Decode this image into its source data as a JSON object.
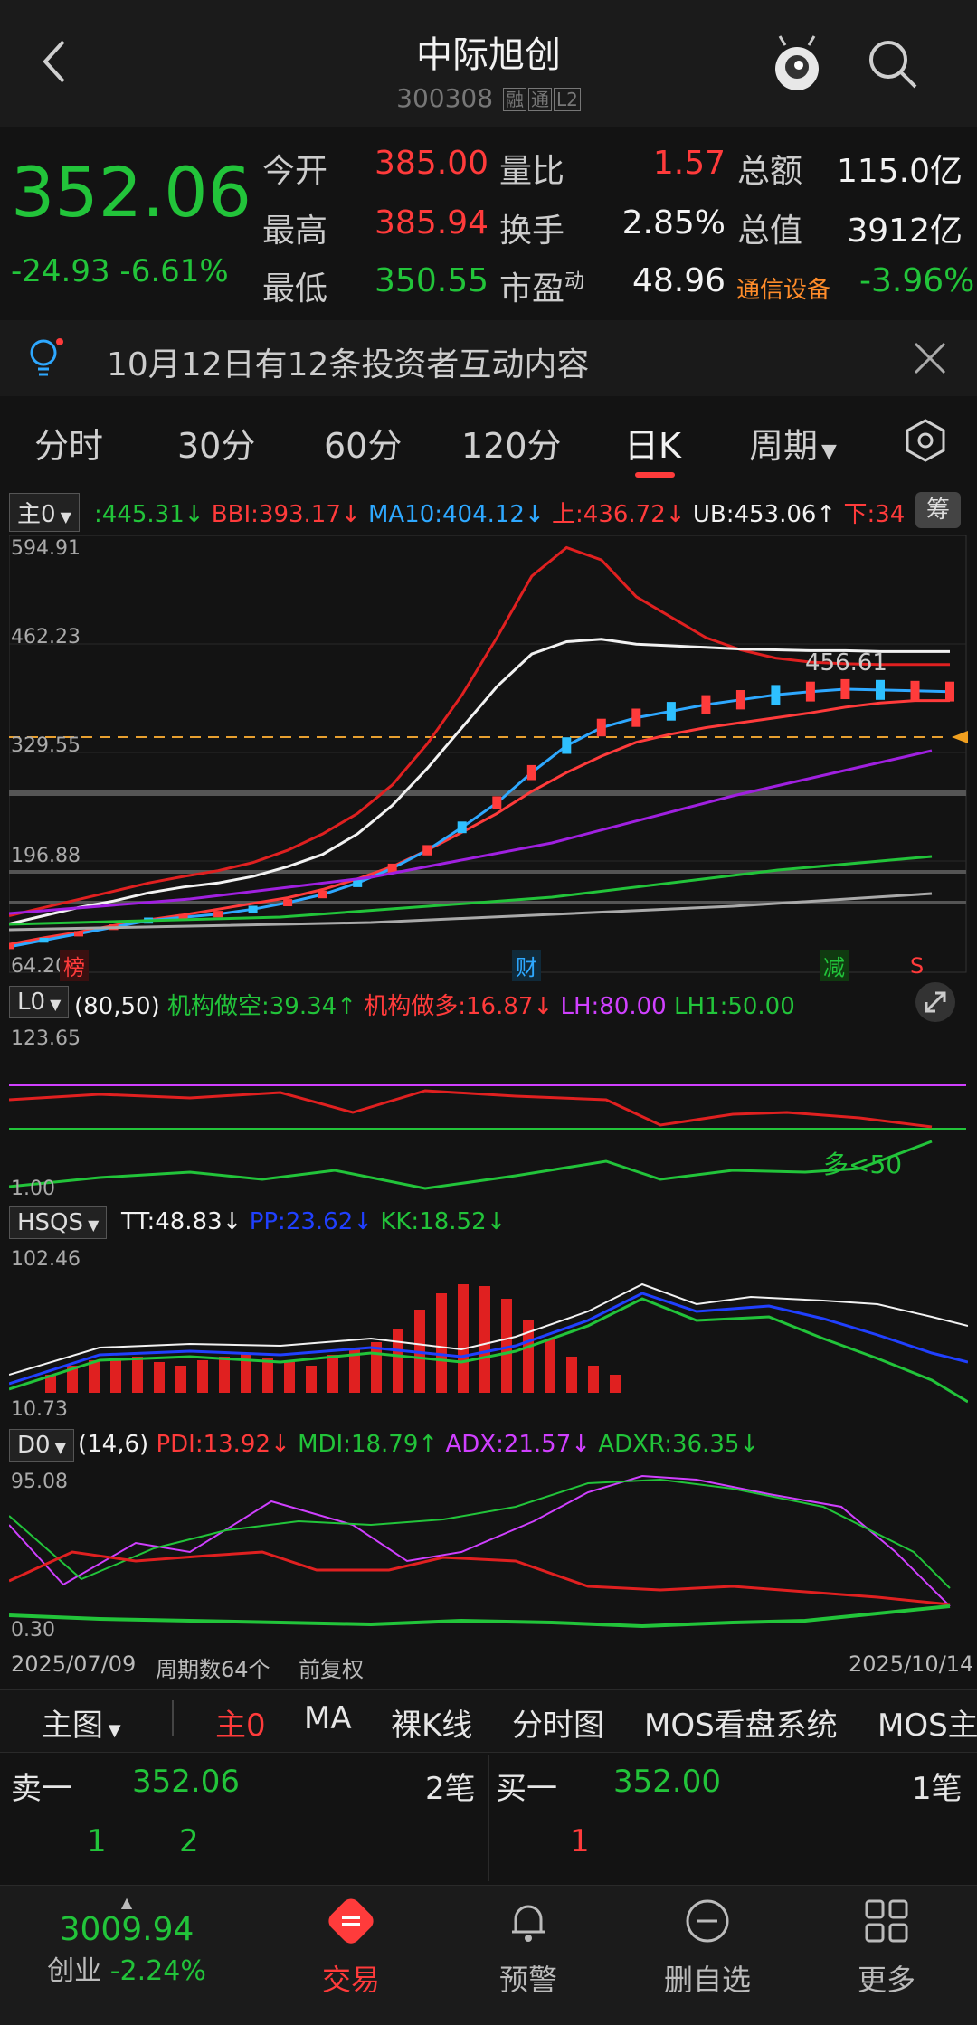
{
  "header": {
    "title": "中际旭创",
    "code": "300308",
    "tags": [
      "融",
      "通",
      "L2"
    ]
  },
  "quote": {
    "price": "352.06",
    "change": "-24.93",
    "change_pct": "-6.61%",
    "rows": [
      [
        {
          "k": "今开",
          "v": "385.00",
          "c": "red"
        },
        {
          "k": "量比",
          "v": "1.57",
          "c": "red"
        },
        {
          "k": "总额",
          "v": "115.0亿",
          "c": "white"
        }
      ],
      [
        {
          "k": "最高",
          "v": "385.94",
          "c": "red"
        },
        {
          "k": "换手",
          "v": "2.85%",
          "c": "white"
        },
        {
          "k": "总值",
          "v": "3912亿",
          "c": "white"
        }
      ],
      [
        {
          "k": "最低",
          "v": "350.55",
          "c": "green"
        },
        {
          "k": "市盈",
          "sup": "动",
          "v": "48.96",
          "c": "white"
        },
        {
          "k": "通信设备",
          "v": "-3.96%",
          "c": "green"
        }
      ]
    ]
  },
  "notice": {
    "text": "10月12日有12条投资者互动内容"
  },
  "tabs": [
    "分时",
    "30分",
    "60分",
    "120分",
    "日K",
    "周期"
  ],
  "main_chart": {
    "selector": "主0",
    "indicators": [
      {
        "t": ":445.31↓",
        "c": "#22c43a"
      },
      {
        "t": "BBI:393.17↓",
        "c": "#ff3b3b"
      },
      {
        "t": "MA10:404.12↓",
        "c": "#2ea8ff"
      },
      {
        "t": "上:436.72↓",
        "c": "#ff3b3b"
      },
      {
        "t": "UB:453.06↑",
        "c": "#f2f2f2"
      },
      {
        "t": "下:34",
        "c": "#ff3b3b"
      }
    ],
    "chip_label": "筹",
    "y_labels": [
      "594.91",
      "462.23",
      "329.55",
      "196.88",
      "64.20"
    ],
    "last_price": "456.61",
    "markers": [
      "榜",
      "财",
      "减",
      "S"
    ]
  },
  "l0": {
    "selector": "L0",
    "params": "(80,50)",
    "indicators": [
      {
        "t": "机构做空:39.34↑",
        "c": "#22c43a"
      },
      {
        "t": "机构做多:16.87↓",
        "c": "#ff3b3b"
      },
      {
        "t": "LH:80.00",
        "c": "#d040ff"
      },
      {
        "t": "LH1:50.00",
        "c": "#22c43a"
      }
    ],
    "y_labels": [
      "123.65",
      "1.00"
    ],
    "note": "多<50"
  },
  "hsqs": {
    "selector": "HSQS",
    "indicators": [
      {
        "t": "TT:48.83↓",
        "c": "#f2f2f2"
      },
      {
        "t": "PP:23.62↓",
        "c": "#2040ff"
      },
      {
        "t": "KK:18.52↓",
        "c": "#22c43a"
      }
    ],
    "y_labels": [
      "102.46",
      "10.73"
    ]
  },
  "d0": {
    "selector": "D0",
    "params": "(14,6)",
    "indicators": [
      {
        "t": "PDI:13.92↓",
        "c": "#ff3b3b"
      },
      {
        "t": "MDI:18.79↑",
        "c": "#22c43a"
      },
      {
        "t": "ADX:21.57↓",
        "c": "#d040ff"
      },
      {
        "t": "ADXR:36.35↓",
        "c": "#22c43a"
      }
    ],
    "y_labels": [
      "95.08",
      "0.30"
    ]
  },
  "footer_info": {
    "start": "2025/07/09",
    "count": "周期数64个",
    "adjust": "前复权",
    "end": "2025/10/14"
  },
  "subtabs": {
    "main": "主图",
    "items": [
      "主0",
      "MA",
      "裸K线",
      "分时图",
      "MOS看盘系统",
      "MOS主"
    ]
  },
  "orderbook": {
    "sell_label": "卖一",
    "sell_price": "352.06",
    "sell_count": "2笔",
    "buy_label": "买一",
    "buy_price": "352.00",
    "buy_count": "1笔",
    "sell_q1": "1",
    "sell_q2": "2",
    "buy_q1": "1"
  },
  "index": {
    "value": "3009.94",
    "label": "创业",
    "change": "-2.24%"
  },
  "nav": [
    "交易",
    "预警",
    "删自选",
    "更多"
  ],
  "colors": {
    "up": "#ff3b3b",
    "down": "#22c43a",
    "bg": "#131313",
    "accent": "#ff3b3b"
  },
  "chart_data": {
    "type": "line",
    "title": "",
    "x_range": [
      "2025/07/09",
      "2025/10/14"
    ],
    "ylim": [
      64.2,
      594.91
    ],
    "series": [
      {
        "name": "BBI",
        "values": [
          95,
          103,
          110,
          118,
          125,
          131,
          138,
          145,
          152,
          162,
          175,
          190,
          210,
          232,
          255,
          282,
          305,
          325,
          342,
          352,
          360,
          366,
          372,
          378,
          385,
          390,
          393,
          393
        ]
      },
      {
        "name": "MA10",
        "values": [
          92,
          100,
          108,
          116,
          124,
          128,
          132,
          138,
          146,
          156,
          170,
          188,
          210,
          238,
          268,
          305,
          338,
          360,
          372,
          380,
          388,
          394,
          400,
          404,
          407,
          406,
          405,
          404
        ]
      },
      {
        "name": "上",
        "values": [
          130,
          140,
          150,
          160,
          170,
          178,
          185,
          195,
          210,
          230,
          255,
          290,
          340,
          400,
          470,
          545,
          580,
          565,
          520,
          495,
          470,
          455,
          445,
          440,
          438,
          437,
          437,
          437
        ]
      },
      {
        "name": "UB",
        "values": [
          120,
          130,
          140,
          148,
          158,
          165,
          170,
          178,
          190,
          205,
          230,
          265,
          310,
          360,
          410,
          450,
          465,
          468,
          462,
          460,
          458,
          456,
          455,
          454,
          454,
          453,
          453,
          453
        ]
      }
    ]
  }
}
